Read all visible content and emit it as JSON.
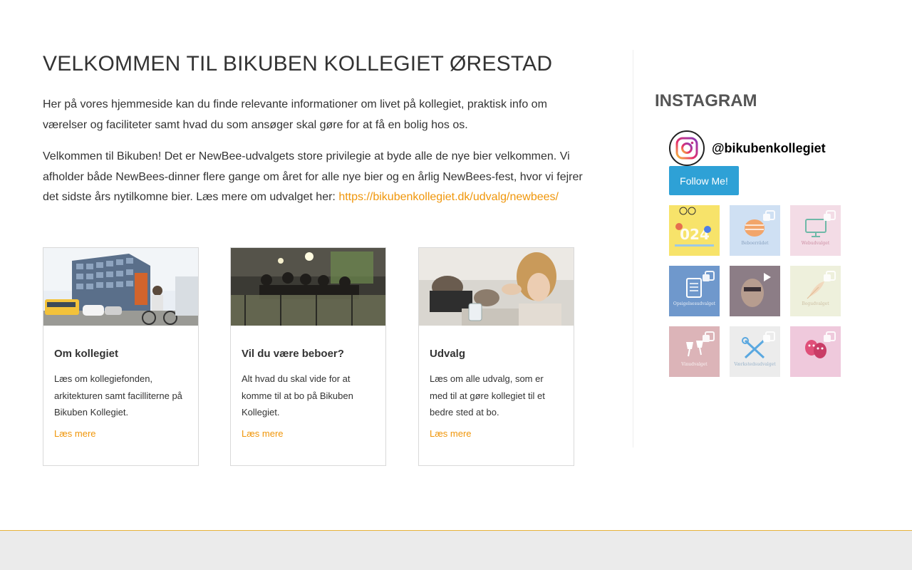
{
  "main": {
    "title": "VELKOMMEN TIL BIKUBEN KOLLEGIET ØRESTAD",
    "paragraph1": "Her på vores hjemmeside kan du finde relevante informationer om livet på kollegiet, praktisk info om værelser og faciliteter samt hvad du som ansøger skal gøre for at få en bolig hos os.",
    "paragraph2": "Velkommen til Bikuben! Det er NewBee-udvalgets store privilegie at byde alle de nye bier velkommen. Vi afholder både NewBees-dinner flere gange om året for alle nye bier og en årlig NewBees-fest, hvor vi fejrer det sidste års nytilkomne bier. Læs mere om udvalget her: ",
    "paragraph2_link": "https://bikubenkollegiet.dk/udvalg/newbees/"
  },
  "cards": [
    {
      "title": "Om kollegiet",
      "text": "Læs om kollegiefonden, arkitekturen samt facilliterne på Bikuben Kollegiet.",
      "link": "Læs mere"
    },
    {
      "title": "Vil du være beboer?",
      "text": "Alt hvad du skal vide for at komme til at bo på Bikuben Kollegiet.",
      "link": "Læs mere"
    },
    {
      "title": "Udvalg",
      "text": "Læs om alle udvalg, som er med til at gøre kollegiet til et bedre sted at bo.",
      "link": "Læs mere"
    }
  ],
  "sidebar": {
    "title": "INSTAGRAM",
    "handle": "@bikubenkollegiet",
    "follow_label": "Follow Me!",
    "tiles": [
      {
        "icon": "event-poster-icon",
        "caption": "",
        "color": "#f7e36a",
        "kind": "image"
      },
      {
        "icon": "hive-icon",
        "caption": "Beboerrådet",
        "color": "#cfe0f3",
        "kind": "carousel"
      },
      {
        "icon": "monitor-icon",
        "caption": "Webudvalget",
        "color": "#f3dce6",
        "kind": "carousel"
      },
      {
        "icon": "clipboard-icon",
        "caption": "Opsigelsesudvalget",
        "color": "#6f98cc",
        "kind": "carousel"
      },
      {
        "icon": "play-icon",
        "caption": "",
        "color": "#8c7d86",
        "kind": "video"
      },
      {
        "icon": "feather-icon",
        "caption": "Bogudvalget",
        "color": "#eef0dc",
        "kind": "carousel"
      },
      {
        "icon": "cheers-icon",
        "caption": "Vinudvalget",
        "color": "#dcb4b8",
        "kind": "carousel"
      },
      {
        "icon": "tools-icon",
        "caption": "Værkstedsudvalget",
        "color": "#ececec",
        "kind": "carousel"
      },
      {
        "icon": "theatre-masks-icon",
        "caption": "",
        "color": "#efc9dc",
        "kind": "carousel"
      }
    ]
  },
  "colors": {
    "accent": "#f0960a",
    "button": "#2ea1d6",
    "footer_border": "#e6b23a",
    "footer_bg": "#ebebeb"
  }
}
